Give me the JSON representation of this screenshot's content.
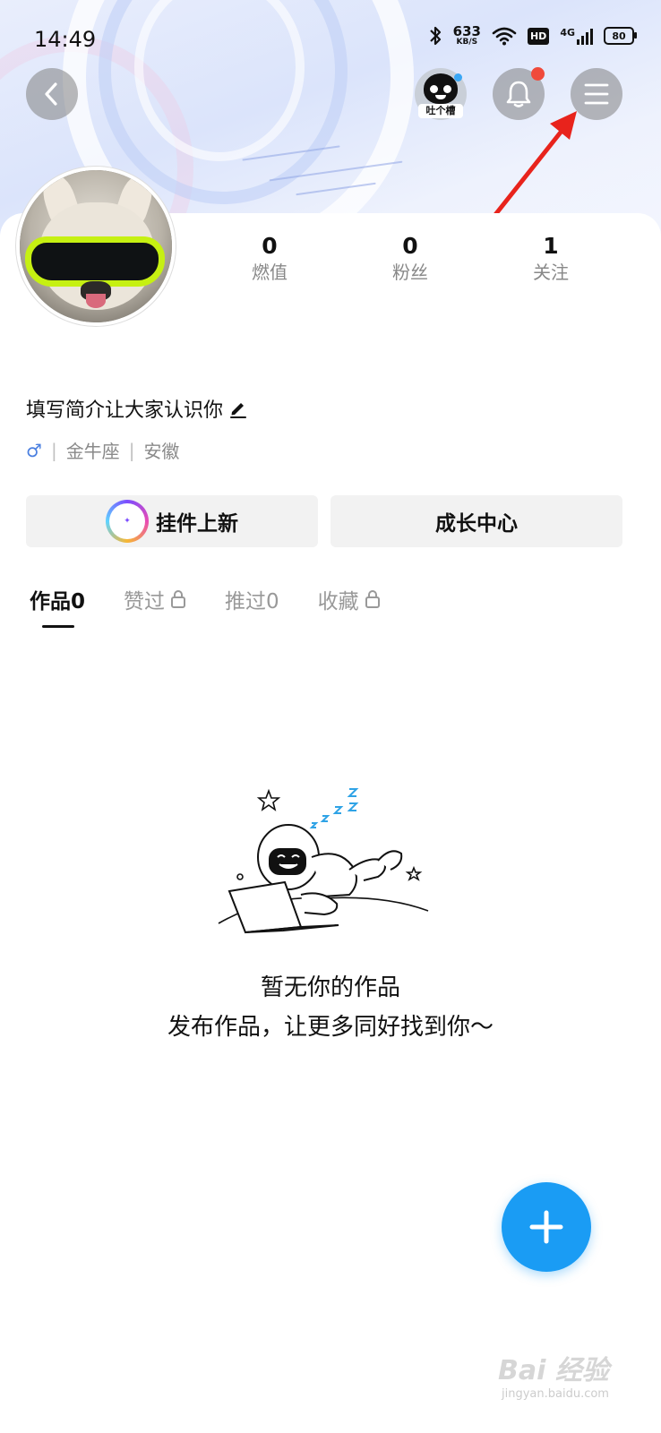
{
  "status_bar": {
    "time": "14:49",
    "net_speed_value": "633",
    "net_speed_unit": "KB/S",
    "hd_badge": "HD",
    "network_type": "4G",
    "battery": "80"
  },
  "header": {
    "tucao_label": "吐个槽",
    "notification_dot_color": "#f04a3b"
  },
  "stats": [
    {
      "value": "0",
      "label": "燃值"
    },
    {
      "value": "0",
      "label": "粉丝"
    },
    {
      "value": "1",
      "label": "关注"
    }
  ],
  "profile": {
    "bio_placeholder": "填写简介让大家认识你",
    "gender_symbol": "♂",
    "zodiac": "金牛座",
    "location": "安徽"
  },
  "actions": {
    "pendant_label": "挂件上新",
    "growth_label": "成长中心"
  },
  "tabs": [
    {
      "label": "作品0",
      "locked": false,
      "active": true
    },
    {
      "label": "赞过",
      "locked": true,
      "active": false
    },
    {
      "label": "推过0",
      "locked": false,
      "active": false
    },
    {
      "label": "收藏",
      "locked": true,
      "active": false
    }
  ],
  "empty_state": {
    "title": "暂无你的作品",
    "subtitle": "发布作品，让更多同好找到你～"
  },
  "fab": {
    "color": "#1a9cf4"
  },
  "watermark": {
    "main": "Bai 经验",
    "sub": "jingyan.baidu.com"
  },
  "colors": {
    "accent": "#1a9cf4",
    "annotation_arrow": "#e8231c"
  }
}
